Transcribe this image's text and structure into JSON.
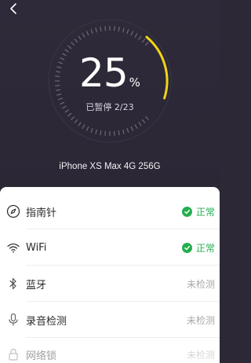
{
  "header": {
    "back_icon": "chevron-left-icon"
  },
  "gauge": {
    "percent": "25",
    "unit": "%",
    "progress": 0.25,
    "status_text": "已暂停 2/23",
    "device": "iPhone XS Max 4G 256G",
    "colors": {
      "active": "#f0d417",
      "inactive": "#6e6a78",
      "background": "#2c2836"
    }
  },
  "checks": [
    {
      "icon": "compass-icon",
      "label": "指南针",
      "state": "正常",
      "ok": true
    },
    {
      "icon": "wifi-icon",
      "label": "WiFi",
      "state": "正常",
      "ok": true
    },
    {
      "icon": "bluetooth-icon",
      "label": "蓝牙",
      "state": "未检测",
      "ok": false
    },
    {
      "icon": "microphone-icon",
      "label": "录音检测",
      "state": "未检测",
      "ok": false
    },
    {
      "icon": "lock-icon",
      "label": "网络锁",
      "state": "未检测",
      "ok": false
    }
  ],
  "colors": {
    "ok": "#2ab053",
    "pending": "#a9a9a9"
  }
}
